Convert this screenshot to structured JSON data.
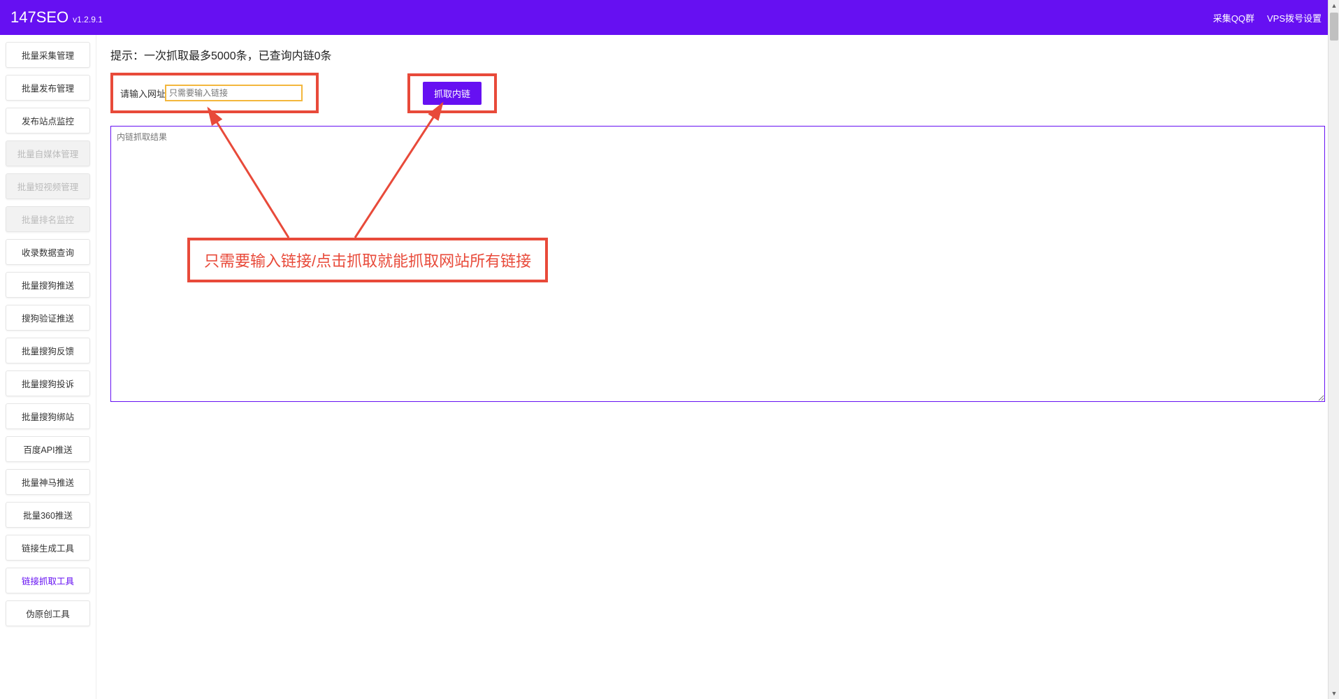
{
  "header": {
    "brand": "147SEO",
    "version": "v1.2.9.1",
    "links": {
      "qq_group": "采集QQ群",
      "vps_settings": "VPS拨号设置"
    }
  },
  "sidebar": {
    "items": [
      {
        "label": "批量采集管理",
        "state": "normal"
      },
      {
        "label": "批量发布管理",
        "state": "normal"
      },
      {
        "label": "发布站点监控",
        "state": "normal"
      },
      {
        "label": "批量自媒体管理",
        "state": "disabled"
      },
      {
        "label": "批量短视频管理",
        "state": "disabled"
      },
      {
        "label": "批量排名监控",
        "state": "disabled"
      },
      {
        "label": "收录数据查询",
        "state": "normal"
      },
      {
        "label": "批量搜狗推送",
        "state": "normal"
      },
      {
        "label": "搜狗验证推送",
        "state": "normal"
      },
      {
        "label": "批量搜狗反馈",
        "state": "normal"
      },
      {
        "label": "批量搜狗投诉",
        "state": "normal"
      },
      {
        "label": "批量搜狗绑站",
        "state": "normal"
      },
      {
        "label": "百度API推送",
        "state": "normal"
      },
      {
        "label": "批量神马推送",
        "state": "normal"
      },
      {
        "label": "批量360推送",
        "state": "normal"
      },
      {
        "label": "链接生成工具",
        "state": "normal"
      },
      {
        "label": "链接抓取工具",
        "state": "active"
      },
      {
        "label": "伪原创工具",
        "state": "normal"
      }
    ]
  },
  "main": {
    "hint": "提示：一次抓取最多5000条，已查询内链0条",
    "input_label": "请输入网址",
    "input_placeholder": "只需要输入链接",
    "crawl_button": "抓取内链",
    "result_placeholder": "内链抓取结果",
    "annotation": "只需要输入链接/点击抓取就能抓取网站所有链接"
  },
  "colors": {
    "primary": "#6610f2",
    "annotation_red": "#e84a3a",
    "input_highlight": "#f3b73d"
  }
}
